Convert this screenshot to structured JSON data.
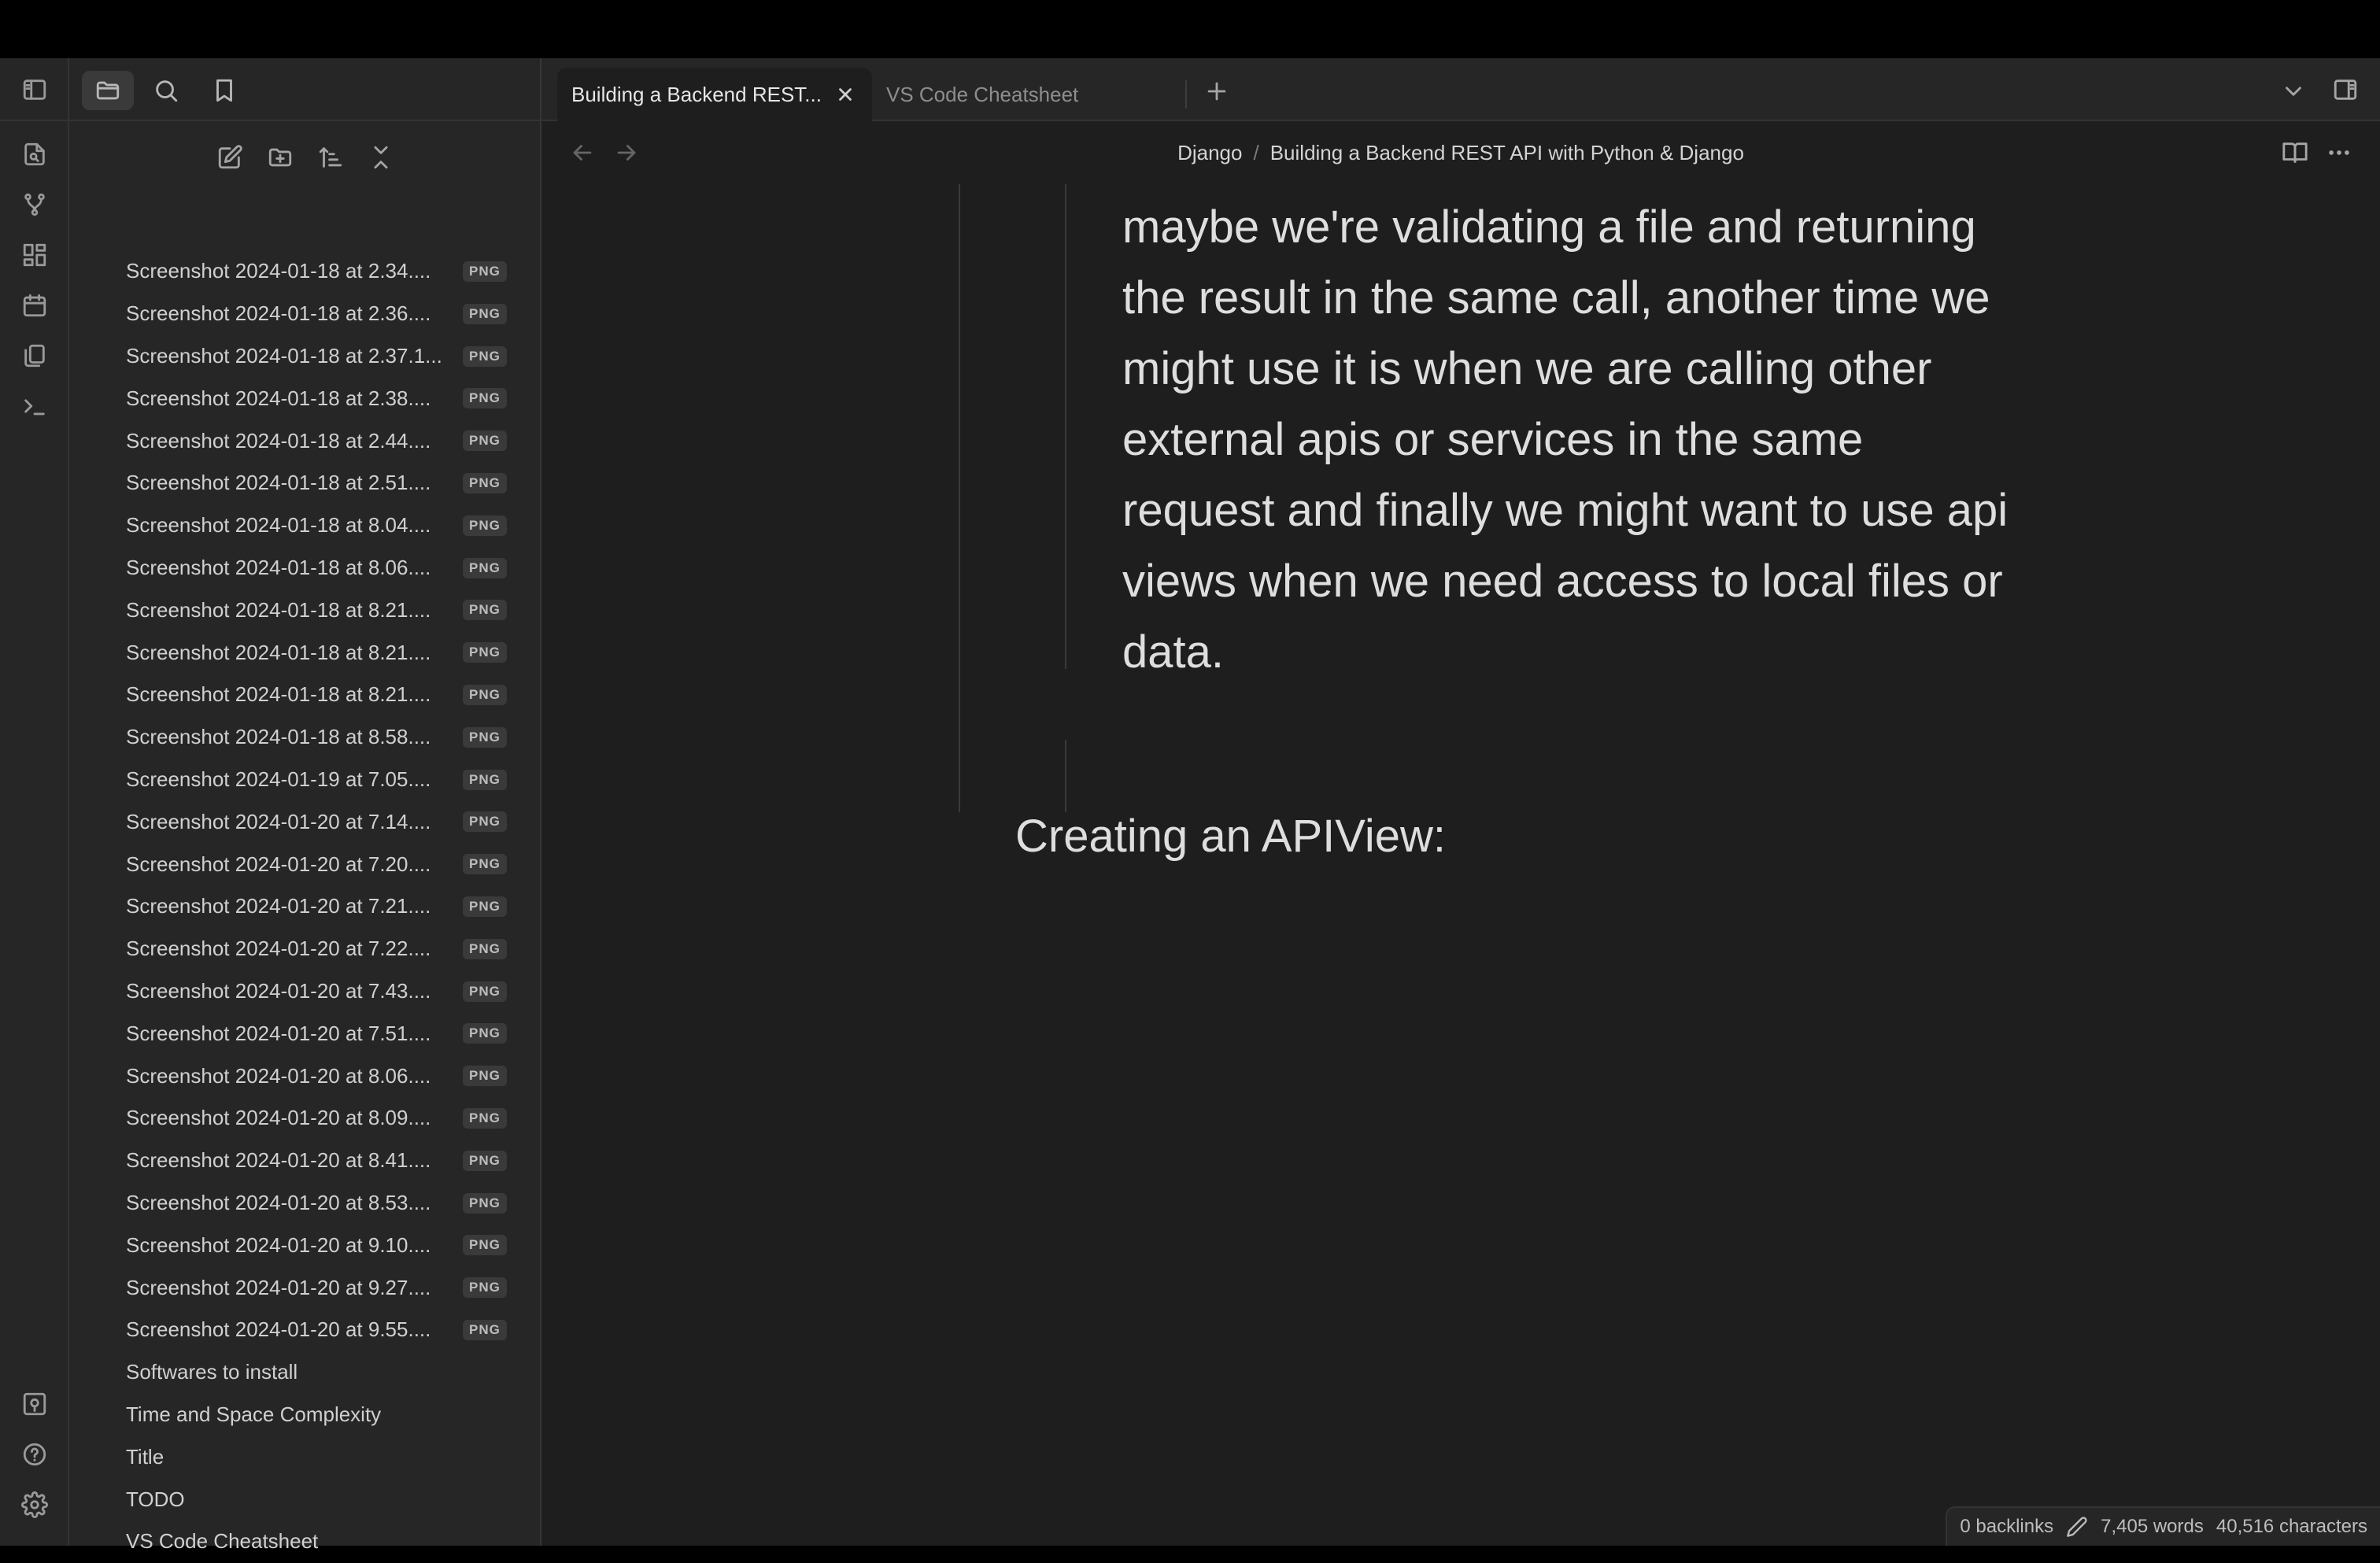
{
  "sidebar": {
    "files": [
      {
        "name": "Screenshot 2024-01-18 at 2.34....",
        "tag": "PNG"
      },
      {
        "name": "Screenshot 2024-01-18 at 2.36....",
        "tag": "PNG"
      },
      {
        "name": "Screenshot 2024-01-18 at 2.37.1...",
        "tag": "PNG"
      },
      {
        "name": "Screenshot 2024-01-18 at 2.38....",
        "tag": "PNG"
      },
      {
        "name": "Screenshot 2024-01-18 at 2.44....",
        "tag": "PNG"
      },
      {
        "name": "Screenshot 2024-01-18 at 2.51....",
        "tag": "PNG"
      },
      {
        "name": "Screenshot 2024-01-18 at 8.04....",
        "tag": "PNG"
      },
      {
        "name": "Screenshot 2024-01-18 at 8.06....",
        "tag": "PNG"
      },
      {
        "name": "Screenshot 2024-01-18 at 8.21....",
        "tag": "PNG"
      },
      {
        "name": "Screenshot 2024-01-18 at 8.21....",
        "tag": "PNG"
      },
      {
        "name": "Screenshot 2024-01-18 at 8.21....",
        "tag": "PNG"
      },
      {
        "name": "Screenshot 2024-01-18 at 8.58....",
        "tag": "PNG"
      },
      {
        "name": "Screenshot 2024-01-19 at 7.05....",
        "tag": "PNG"
      },
      {
        "name": "Screenshot 2024-01-20 at 7.14....",
        "tag": "PNG"
      },
      {
        "name": "Screenshot 2024-01-20 at 7.20....",
        "tag": "PNG"
      },
      {
        "name": "Screenshot 2024-01-20 at 7.21....",
        "tag": "PNG"
      },
      {
        "name": "Screenshot 2024-01-20 at 7.22....",
        "tag": "PNG"
      },
      {
        "name": "Screenshot 2024-01-20 at 7.43....",
        "tag": "PNG"
      },
      {
        "name": "Screenshot 2024-01-20 at 7.51....",
        "tag": "PNG"
      },
      {
        "name": "Screenshot 2024-01-20 at 8.06....",
        "tag": "PNG"
      },
      {
        "name": "Screenshot 2024-01-20 at 8.09....",
        "tag": "PNG"
      },
      {
        "name": "Screenshot 2024-01-20 at 8.41....",
        "tag": "PNG"
      },
      {
        "name": "Screenshot 2024-01-20 at 8.53....",
        "tag": "PNG"
      },
      {
        "name": "Screenshot 2024-01-20 at 9.10....",
        "tag": "PNG"
      },
      {
        "name": "Screenshot 2024-01-20 at 9.27....",
        "tag": "PNG"
      },
      {
        "name": "Screenshot 2024-01-20 at 9.55....",
        "tag": "PNG"
      },
      {
        "name": "Softwares to install",
        "tag": ""
      },
      {
        "name": "Time and Space Complexity",
        "tag": ""
      },
      {
        "name": "Title",
        "tag": ""
      },
      {
        "name": "TODO",
        "tag": ""
      },
      {
        "name": "VS Code Cheatsheet",
        "tag": ""
      }
    ]
  },
  "tabs": [
    {
      "label": "Building a Backend REST..."
    },
    {
      "label": "VS Code Cheatsheet"
    }
  ],
  "breadcrumb": {
    "folder": "Django",
    "separator": "/",
    "note": "Building a Backend REST API with Python & Django"
  },
  "editor": {
    "paragraph": "maybe we're validating a file and returning the result in the same call, another time we might use it is when we are calling other external apis or services in the same request and finally we might want to use api views when we need access to local files or data.",
    "heading": "Creating an APIView:"
  },
  "status": {
    "backlinks": "0 backlinks",
    "words": "7,405 words",
    "characters": "40,516 characters"
  },
  "icons": {
    "ribbon": [
      "sidebar-toggle-icon",
      "open-quick-switcher-icon",
      "graph-view-icon",
      "canvas-icon",
      "daily-notes-icon",
      "templates-icon",
      "command-palette-icon",
      "vault-switcher-icon",
      "help-icon",
      "settings-icon"
    ],
    "sidebar_tabs": [
      "files-icon",
      "search-icon",
      "bookmarks-icon"
    ],
    "file_actions": [
      "new-note-icon",
      "new-folder-icon",
      "sort-icon",
      "collapse-all-icon"
    ]
  }
}
